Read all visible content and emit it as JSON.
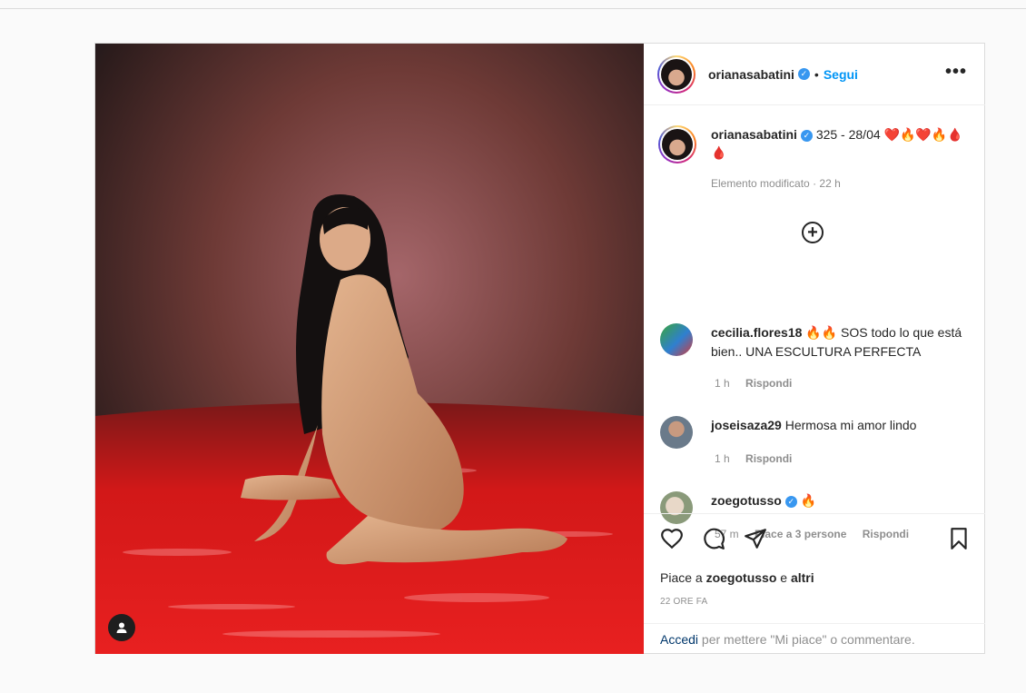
{
  "post": {
    "author": "orianasabatini",
    "follow_label": "Segui",
    "more_glyph": "•••",
    "separator": "•",
    "caption_user": "orianasabatini",
    "caption_text": "325 - 28/04 ❤️🔥❤️🔥🩸🩸",
    "edited_label": "Elemento modificato",
    "edited_time": "22 h",
    "load_more_glyph": "+",
    "comments": [
      {
        "user": "cecilia.flores18",
        "text": "🔥🔥 SOS todo lo que está bien.. UNA ESCULTURA PERFECTA",
        "time": "1 h",
        "reply": "Rispondi"
      },
      {
        "user": "joseisaza29",
        "text": "Hermosa mi amor lindo",
        "time": "1 h",
        "reply": "Rispondi"
      },
      {
        "user": "zoegotusso",
        "text": "🔥",
        "time": "57 m",
        "likes": "Piace a 3 persone",
        "reply": "Rispondi"
      }
    ],
    "likes_prefix": "Piace a",
    "likes_user": "zoegotusso",
    "likes_conj": "e",
    "likes_others": "altri",
    "time_ago": "22 ORE FA",
    "login_link": "Accedi",
    "login_text": "per mettere \"Mi piace\" o commentare."
  },
  "icons": {
    "like": "heart-icon",
    "comment": "comment-icon",
    "share": "paper-plane-icon",
    "save": "bookmark-icon",
    "tags": "user-icon",
    "verified": "verified-badge-icon",
    "more": "more-options-icon",
    "load_more": "plus-circle-icon"
  },
  "colors": {
    "accent": "#0095f6",
    "verified": "#3897f0",
    "text": "#262626",
    "muted": "#8e8e8e"
  }
}
